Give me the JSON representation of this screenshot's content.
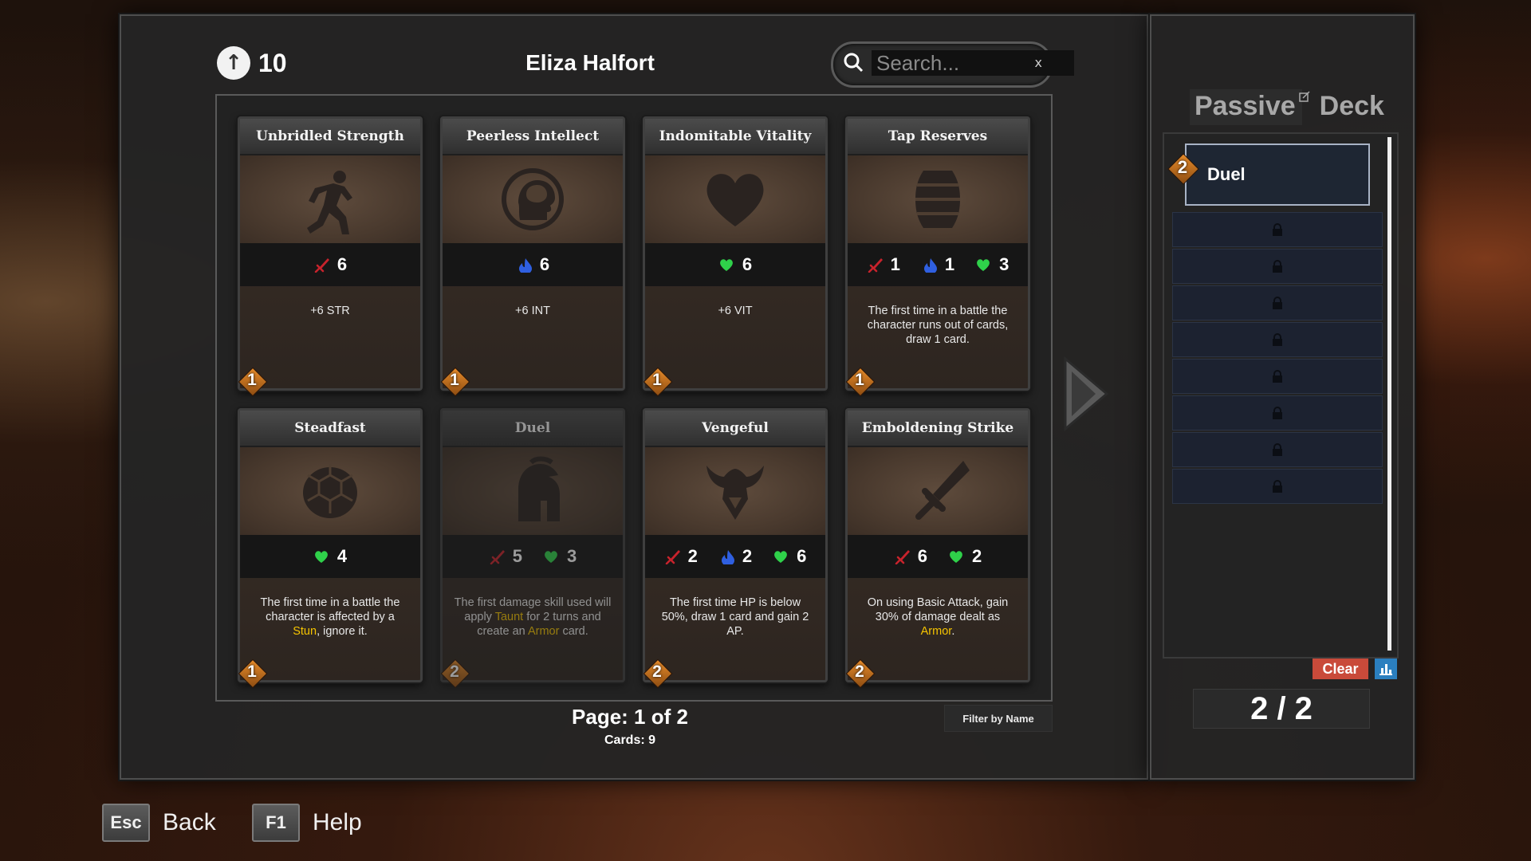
{
  "header": {
    "ap_value": "10",
    "character_name": "Eliza Halfort"
  },
  "search": {
    "placeholder": "Search...",
    "clear_label": "x"
  },
  "cards": [
    {
      "title": "Unbridled Strength",
      "icon": "running-figure-icon",
      "stats": [
        {
          "type": "strength",
          "value": "6"
        }
      ],
      "desc": [
        {
          "t": "+6 STR"
        }
      ],
      "cost": "1",
      "dim": false
    },
    {
      "title": "Peerless Intellect",
      "icon": "brain-head-icon",
      "stats": [
        {
          "type": "intellect",
          "value": "6"
        }
      ],
      "desc": [
        {
          "t": "+6 INT"
        }
      ],
      "cost": "1",
      "dim": false
    },
    {
      "title": "Indomitable Vitality",
      "icon": "heart-icon",
      "stats": [
        {
          "type": "vitality",
          "value": "6"
        }
      ],
      "desc": [
        {
          "t": "+6 VIT"
        }
      ],
      "cost": "1",
      "dim": false
    },
    {
      "title": "Tap Reserves",
      "icon": "barrel-icon",
      "stats": [
        {
          "type": "strength",
          "value": "1"
        },
        {
          "type": "intellect",
          "value": "1"
        },
        {
          "type": "vitality",
          "value": "3"
        }
      ],
      "desc": [
        {
          "t": "The first time in a battle the character runs out of cards, draw 1 card."
        }
      ],
      "cost": "1",
      "dim": false
    },
    {
      "title": "Steadfast",
      "icon": "turtle-shell-icon",
      "stats": [
        {
          "type": "vitality",
          "value": "4"
        }
      ],
      "desc": [
        {
          "t": "The first time in a battle the character is affected by a "
        },
        {
          "t": "Stun",
          "k": true
        },
        {
          "t": ", ignore it."
        }
      ],
      "cost": "1",
      "dim": false
    },
    {
      "title": "Duel",
      "icon": "spartan-helmet-icon",
      "stats": [
        {
          "type": "strength",
          "value": "5"
        },
        {
          "type": "vitality",
          "value": "3"
        }
      ],
      "desc": [
        {
          "t": "The first damage skill used will apply "
        },
        {
          "t": "Taunt",
          "k": true
        },
        {
          "t": " for 2 turns and create an "
        },
        {
          "t": "Armor",
          "k": true
        },
        {
          "t": " card."
        }
      ],
      "cost": "2",
      "dim": true
    },
    {
      "title": "Vengeful",
      "icon": "horned-helmet-icon",
      "stats": [
        {
          "type": "strength",
          "value": "2"
        },
        {
          "type": "intellect",
          "value": "2"
        },
        {
          "type": "vitality",
          "value": "6"
        }
      ],
      "desc": [
        {
          "t": "The first time HP is below 50%, draw 1 card and gain 2 AP."
        }
      ],
      "cost": "2",
      "dim": false
    },
    {
      "title": "Emboldening Strike",
      "icon": "sword-icon",
      "stats": [
        {
          "type": "strength",
          "value": "6"
        },
        {
          "type": "vitality",
          "value": "2"
        }
      ],
      "desc": [
        {
          "t": "On using Basic Attack, gain 30% of damage dealt as "
        },
        {
          "t": "Armor",
          "k": true
        },
        {
          "t": "."
        }
      ],
      "cost": "2",
      "dim": false
    }
  ],
  "pagination": {
    "page_label": "Page: 1 of 2",
    "cards_label": "Cards: 9"
  },
  "filter": {
    "label": "Filter by Name"
  },
  "side": {
    "tab_passive": "Passive",
    "tab_deck": "Deck",
    "deck_entry": {
      "name": "Duel",
      "cost": "2"
    },
    "locked_slots": 8,
    "clear_label": "Clear",
    "count_label": "2 / 2"
  },
  "footer": {
    "back_key": "Esc",
    "back_label": "Back",
    "help_key": "F1",
    "help_label": "Help"
  },
  "colors": {
    "strength": "#c8232c",
    "intellect": "#2f5fe0",
    "vitality": "#2fd14a",
    "keyword": "#f5c400",
    "clear": "#c94a3a",
    "cost": "#e68b2a"
  }
}
